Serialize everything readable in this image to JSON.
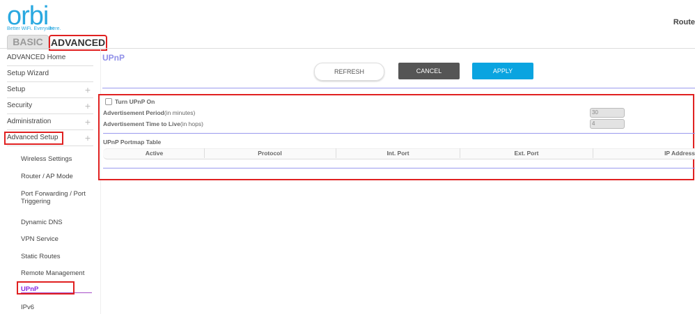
{
  "brand": {
    "logo": "orbi",
    "tm": "TM",
    "tagline": "Better WiFi. Everywhere."
  },
  "tabs": {
    "basic": "BASIC",
    "advanced": "ADVANCED"
  },
  "header_right": "Route",
  "menu": [
    {
      "label": "ADVANCED Home"
    },
    {
      "label": "Setup Wizard"
    },
    {
      "label": "Setup",
      "plus": "+"
    },
    {
      "label": "Security",
      "plus": "+"
    },
    {
      "label": "Administration",
      "plus": "+"
    },
    {
      "label": "Advanced Setup",
      "plus": "+"
    }
  ],
  "submenu": [
    "Wireless Settings",
    "Router / AP Mode",
    "Port Forwarding / Port Triggering",
    "Dynamic DNS",
    "VPN Service",
    "Static Routes",
    "Remote Management",
    "UPnP",
    "IPv6"
  ],
  "page": {
    "title": "UPnP",
    "refresh": "REFRESH",
    "cancel": "CANCEL",
    "apply": "APPLY",
    "turn_on": "Turn UPnP On",
    "period_label": "Advertisement Period",
    "period_unit": "(in minutes)",
    "period_value": "30",
    "ttl_label": "Advertisement Time to Live",
    "ttl_unit": "(in hops)",
    "ttl_value": "4",
    "table_title": "UPnP Portmap Table",
    "columns": [
      "Active",
      "Protocol",
      "Int. Port",
      "Ext. Port",
      "IP Address"
    ]
  },
  "colors": {
    "accent": "#29a8e0",
    "apply": "#0aa4e0",
    "cancel": "#555555",
    "highlight": "#e02020"
  }
}
